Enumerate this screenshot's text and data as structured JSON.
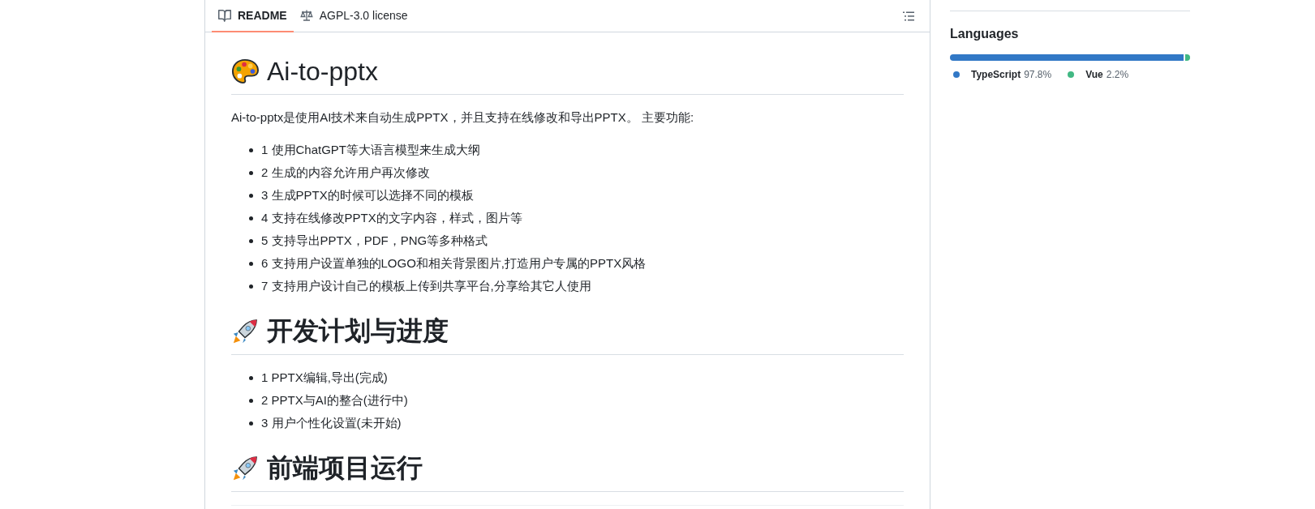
{
  "tabs": [
    {
      "label": "README",
      "selected": true,
      "kind": "book"
    },
    {
      "label": "AGPL-3.0 license",
      "selected": false,
      "kind": "scale"
    }
  ],
  "readme": {
    "sections": [
      {
        "kind": "palette",
        "heading": "Ai-to-pptx",
        "paragraph": "Ai-to-pptx是使用AI技术来自动生成PPTX，并且支持在线修改和导出PPTX。 主要功能:",
        "items": [
          "1 使用ChatGPT等大语言模型来生成大纲",
          "2 生成的内容允许用户再次修改",
          "3 生成PPTX的时候可以选择不同的模板",
          "4 支持在线修改PPTX的文字内容，样式，图片等",
          "5 支持导出PPTX，PDF，PNG等多种格式",
          "6 支持用户设置单独的LOGO和相关背景图片,打造用户专属的PPTX风格",
          "7 支持用户设计自己的模板上传到共享平台,分享给其它人使用"
        ]
      },
      {
        "kind": "rocket",
        "heading": "开发计划与进度",
        "items": [
          "1 PPTX编辑,导出(完成)",
          "2 PPTX与AI的整合(进行中)",
          "3 用户个性化设置(未开始)"
        ]
      },
      {
        "kind": "rocket",
        "heading": "前端项目运行"
      }
    ]
  },
  "languages": {
    "title": "Languages",
    "items": [
      {
        "name": "TypeScript",
        "percent": "97.8%",
        "color": "#3178c6"
      },
      {
        "name": "Vue",
        "percent": "2.2%",
        "color": "#41b883"
      }
    ]
  }
}
